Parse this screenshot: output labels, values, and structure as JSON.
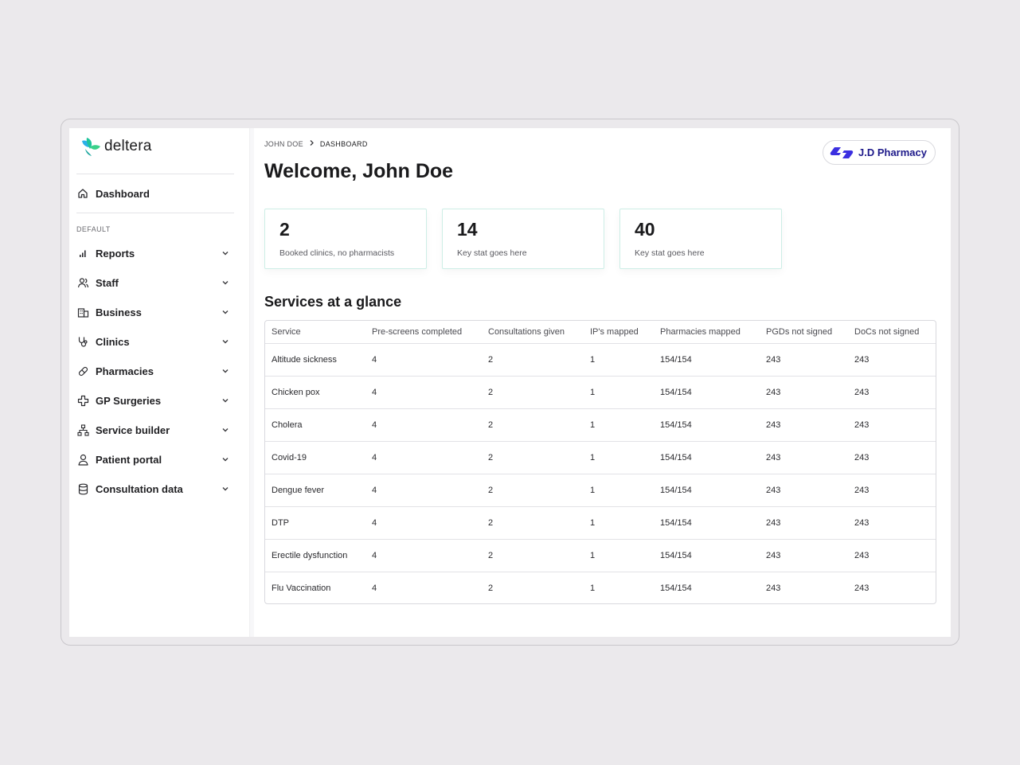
{
  "brand": {
    "name": "deltera",
    "accent": "#1ec49b",
    "accent2": "#2b8ff0"
  },
  "sidebar": {
    "dashboard_label": "Dashboard",
    "section_label": "DEFAULT",
    "items": [
      {
        "label": "Reports",
        "icon": "bar-chart-icon"
      },
      {
        "label": "Staff",
        "icon": "users-icon"
      },
      {
        "label": "Business",
        "icon": "building-icon"
      },
      {
        "label": "Clinics",
        "icon": "stethoscope-icon"
      },
      {
        "label": "Pharmacies",
        "icon": "pill-icon"
      },
      {
        "label": "GP Surgeries",
        "icon": "medical-cross-icon"
      },
      {
        "label": "Service builder",
        "icon": "hierarchy-icon"
      },
      {
        "label": "Patient portal",
        "icon": "user-icon"
      },
      {
        "label": "Consultation data",
        "icon": "database-icon"
      }
    ]
  },
  "breadcrumb": {
    "first": "JOHN DOE",
    "second": "DASHBOARD"
  },
  "header": {
    "title": "Welcome, John Doe"
  },
  "pharmacy": {
    "name": "J.D Pharmacy",
    "color": "#1e1a8a"
  },
  "stats": [
    {
      "value": "2",
      "label": "Booked clinics, no pharmacists"
    },
    {
      "value": "14",
      "label": "Key stat goes here"
    },
    {
      "value": "40",
      "label": "Key stat goes here"
    }
  ],
  "services": {
    "title": "Services at a glance",
    "columns": [
      "Service",
      "Pre-screens completed",
      "Consultations given",
      "IP's mapped",
      "Pharmacies mapped",
      "PGDs not signed",
      "DoCs not signed"
    ],
    "rows": [
      [
        "Altitude sickness",
        "4",
        "2",
        "1",
        "154/154",
        "243",
        "243"
      ],
      [
        "Chicken pox",
        "4",
        "2",
        "1",
        "154/154",
        "243",
        "243"
      ],
      [
        "Cholera",
        "4",
        "2",
        "1",
        "154/154",
        "243",
        "243"
      ],
      [
        "Covid-19",
        "4",
        "2",
        "1",
        "154/154",
        "243",
        "243"
      ],
      [
        "Dengue fever",
        "4",
        "2",
        "1",
        "154/154",
        "243",
        "243"
      ],
      [
        "DTP",
        "4",
        "2",
        "1",
        "154/154",
        "243",
        "243"
      ],
      [
        "Erectile dysfunction",
        "4",
        "2",
        "1",
        "154/154",
        "243",
        "243"
      ],
      [
        "Flu Vaccination",
        "4",
        "2",
        "1",
        "154/154",
        "243",
        "243"
      ]
    ]
  }
}
